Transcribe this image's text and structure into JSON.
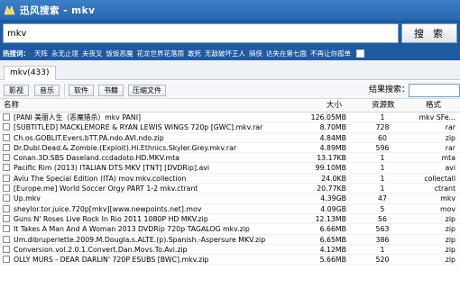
{
  "window": {
    "title": "迅风搜索 - mkv"
  },
  "search": {
    "query": "mkv",
    "button_label": "搜索"
  },
  "hot": {
    "label": "热搜词：",
    "terms": [
      "天阵",
      "永无止境",
      "夫夜叉",
      "饭饭恶魔",
      "花龙世界花落雨",
      "敢死",
      "无敌破坏王人",
      "骑侠",
      "达失在第七面",
      "不再让你孤单"
    ]
  },
  "tab": {
    "label": "mkv(433)"
  },
  "filters": [
    "影视",
    "音乐",
    "软件",
    "书籍",
    "压缩文件"
  ],
  "filter_search": {
    "label": "结果搜索：",
    "value": ""
  },
  "table": {
    "columns": [
      "名称",
      "大小",
      "资源数",
      "格式"
    ],
    "rows": [
      {
        "name": "[PANI 美丽人生（恶魔猎杀）mkv PANI]",
        "size": "126.05MB",
        "res": "1",
        "fmt": "mkv SFe..."
      },
      {
        "name": "[SUBTITLED] MACKLEMORE & RYAN LEWIS WINGS 720p [GWC].mkv.rar",
        "size": "8.70MB",
        "res": "728",
        "fmt": "rar"
      },
      {
        "name": "Ch.os.GOBLIT.Evers.bTT.PA.ndo.AVI.ndo.zip",
        "size": "4.84MB",
        "res": "60",
        "fmt": "zip"
      },
      {
        "name": "Dr.Dubl.Dead.&.Zombie.(Exploit).Hi.Ethnics.Skyler.Grey.mkv.rar",
        "size": "4.89MB",
        "res": "596",
        "fmt": "rar"
      },
      {
        "name": "Conan.3D.SBS Daseland.ccdadoto.HD.MKV.mta",
        "size": "13.17KB",
        "res": "1",
        "fmt": "mta"
      },
      {
        "name": "Pacific Rim (2013) ITALIAN DTS MKV [TNT] [DVDRip].avi",
        "size": "99.10MB",
        "res": "1",
        "fmt": "avi"
      },
      {
        "name": "Aviu The Special Edition (ITA) mov.mkv.collection",
        "size": "24.0KB",
        "res": "1",
        "fmt": "collectall"
      },
      {
        "name": "[Europe.me] World Soccer Orgy PART 1-2 mkv.ctrant",
        "size": "20.77KB",
        "res": "1",
        "fmt": "ctrant"
      },
      {
        "name": "Up.mkv",
        "size": "4.39GB",
        "res": "47",
        "fmt": "mkv"
      },
      {
        "name": "sheylor.tor.juice.720p[mkv][www.newpoints.net].mov",
        "size": "4.09GB",
        "res": "5",
        "fmt": "mov"
      },
      {
        "name": "Guns N' Roses Live Rock In Rio 2011 1080P HD MKV.zip",
        "size": "12.13MB",
        "res": "56",
        "fmt": "zip"
      },
      {
        "name": "It Takes A Man And A Woman 2013 DVDRip 720p TAGALOG mkv.zip",
        "size": "6.66MB",
        "res": "563",
        "fmt": "zip"
      },
      {
        "name": "Um.dibruperlette.2009.M.Dougla.s.ALTE.(p).Spanish.-Aspersure MKV.zip",
        "size": "6.65MB",
        "res": "386",
        "fmt": "zip"
      },
      {
        "name": "Conversion.vol.2.0.1.Convert.Dan.Movs.To.Avi.zip",
        "size": "4.12MB",
        "res": "1",
        "fmt": "zip"
      },
      {
        "name": "OLLY MURS - DEAR DARLIN' 720P ESUBS [BWC].mkv.zip",
        "size": "5.66MB",
        "res": "520",
        "fmt": "zip"
      }
    ]
  }
}
